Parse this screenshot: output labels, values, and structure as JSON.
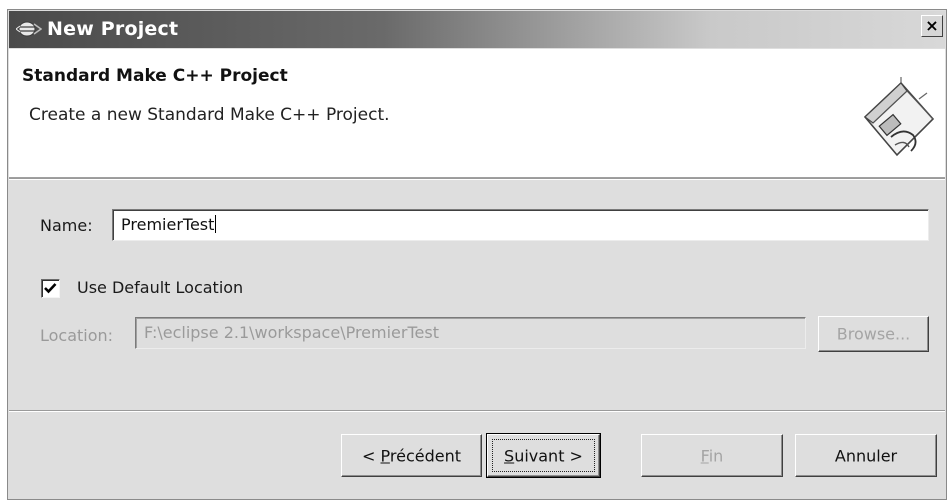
{
  "window": {
    "title": "New Project",
    "close_glyph": "×",
    "title_icon": "eclipse-icon"
  },
  "header": {
    "title": "Standard Make C++ Project",
    "description": "Create a new Standard Make C++ Project.",
    "icon": "new-project-wizard-icon"
  },
  "form": {
    "name_label": "Name:",
    "name_value": "PremierTest",
    "use_default_label": "Use Default Location",
    "use_default_checked": true,
    "location_label": "Location:",
    "location_value": "F:\\eclipse 2.1\\workspace\\PremierTest",
    "browse_label": "Browse..."
  },
  "buttons": {
    "back_prefix": "< ",
    "back_mnemonic": "P",
    "back_rest": "récédent",
    "next_mnemonic": "S",
    "next_rest": "uivant >",
    "finish_mnemonic": "F",
    "finish_rest": "in",
    "cancel_label": "Annuler"
  }
}
